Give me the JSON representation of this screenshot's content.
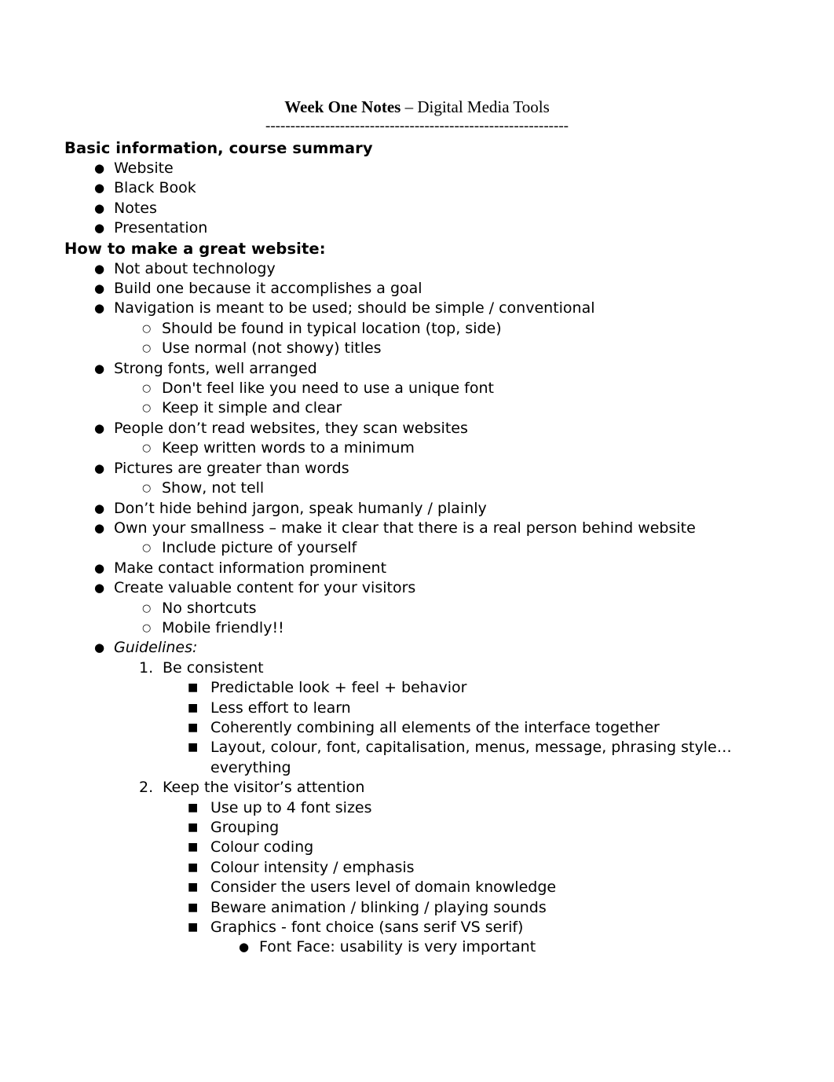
{
  "document": {
    "title_bold": "Week One Notes",
    "title_rest": " – Digital Media Tools",
    "separator": "-------------------------------------------------------------"
  },
  "sections": [
    {
      "header": "Basic information, course summary",
      "items": [
        {
          "level": 1,
          "marker": "●",
          "text": "Website"
        },
        {
          "level": 1,
          "marker": "●",
          "text": "Black Book"
        },
        {
          "level": 1,
          "marker": "●",
          "text": "Notes"
        },
        {
          "level": 1,
          "marker": "●",
          "text": "Presentation"
        }
      ]
    },
    {
      "header": "How to make a great website:",
      "items": [
        {
          "level": 1,
          "marker": "●",
          "text": "Not about technology"
        },
        {
          "level": 1,
          "marker": "●",
          "text": "Build one because it accomplishes a goal"
        },
        {
          "level": 1,
          "marker": "●",
          "text": "Navigation is meant to be used; should be simple / conventional"
        },
        {
          "level": 2,
          "marker": "○",
          "text": "Should be found in typical location (top, side)"
        },
        {
          "level": 2,
          "marker": "○",
          "text": "Use normal (not showy) titles"
        },
        {
          "level": 1,
          "marker": "●",
          "text": "Strong fonts, well arranged"
        },
        {
          "level": 2,
          "marker": "○",
          "text": "Don't feel like you need to use a unique font"
        },
        {
          "level": 2,
          "marker": "○",
          "text": "Keep it simple and clear"
        },
        {
          "level": 1,
          "marker": "●",
          "text": "People don’t read websites, they scan websites"
        },
        {
          "level": 2,
          "marker": "○",
          "text": "Keep written words to a minimum"
        },
        {
          "level": 1,
          "marker": "●",
          "text": "Pictures are greater than words"
        },
        {
          "level": 2,
          "marker": "○",
          "text": "Show, not tell"
        },
        {
          "level": 1,
          "marker": "●",
          "text": "Don’t hide behind jargon, speak humanly / plainly"
        },
        {
          "level": 1,
          "marker": "●",
          "text": "Own your smallness – make it clear that there is a real person behind website"
        },
        {
          "level": 2,
          "marker": "○",
          "text": "Include picture of yourself"
        },
        {
          "level": 1,
          "marker": "●",
          "text": "Make contact information prominent"
        },
        {
          "level": 1,
          "marker": "●",
          "text": "Create valuable content for your visitors"
        },
        {
          "level": 2,
          "marker": "○",
          "text": "No shortcuts"
        },
        {
          "level": 2,
          "marker": "○",
          "text": "Mobile friendly!!"
        },
        {
          "level": 1,
          "marker": "●",
          "text": "Guidelines:",
          "italic": true
        },
        {
          "level": "2n",
          "marker": "1.",
          "text": "Be consistent"
        },
        {
          "level": 3,
          "marker": "■",
          "text": "Predictable look + feel + behavior"
        },
        {
          "level": 3,
          "marker": "■",
          "text": "Less effort to learn"
        },
        {
          "level": 3,
          "marker": "■",
          "text": "Coherently combining all elements of the interface together"
        },
        {
          "level": 3,
          "marker": "■",
          "text": "Layout, colour, font, capitalisation, menus, message, phrasing style… everything"
        },
        {
          "level": "2n",
          "marker": "2.",
          "text": "Keep the visitor’s attention"
        },
        {
          "level": 3,
          "marker": "■",
          "text": "Use up to 4 font sizes"
        },
        {
          "level": 3,
          "marker": "■",
          "text": "Grouping"
        },
        {
          "level": 3,
          "marker": "■",
          "text": "Colour coding"
        },
        {
          "level": 3,
          "marker": "■",
          "text": "Colour intensity / emphasis"
        },
        {
          "level": 3,
          "marker": "■",
          "text": "Consider the users level of domain knowledge"
        },
        {
          "level": 3,
          "marker": "■",
          "text": "Beware animation / blinking / playing sounds"
        },
        {
          "level": 3,
          "marker": "■",
          "text": "Graphics - font choice (sans serif VS serif)"
        },
        {
          "level": 4,
          "marker": "●",
          "text": "Font Face: usability is very important"
        }
      ]
    }
  ]
}
